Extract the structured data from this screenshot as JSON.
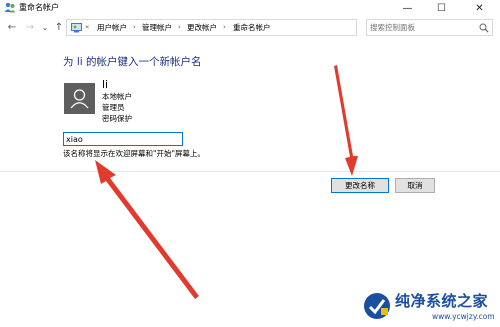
{
  "window": {
    "title": "重命名帐户",
    "min_glyph": "—",
    "max_glyph": "☐",
    "close_glyph": "✕"
  },
  "address_bar": {
    "back_glyph": "←",
    "forward_glyph": "→",
    "recent_glyph": "⌄",
    "up_glyph": "↑",
    "overflow": "«",
    "breadcrumbs": [
      "用户帐户",
      "管理帐户",
      "更改帐户",
      "重命名帐户"
    ],
    "separator": "›",
    "dropdown_glyph": "⌄",
    "refresh_glyph": "↻"
  },
  "search": {
    "placeholder": "搜索控制面板"
  },
  "content": {
    "heading": "为 li 的帐户键入一个新帐户名",
    "user": {
      "name": "li",
      "details": [
        "本地帐户",
        "管理员",
        "密码保护"
      ]
    },
    "new_name_value": "xiao",
    "hint": "该名称将显示在欢迎屏幕和\"开始\"屏幕上。"
  },
  "buttons": {
    "rename": "更改名称",
    "cancel": "取消"
  },
  "watermark": {
    "title": "纯净系统之家",
    "url": "www.ycwjzy.com"
  },
  "colors": {
    "heading": "#1e3287",
    "arrow": "#e23b2e",
    "accent": "#0078d7",
    "avatar_bg": "#5e5e5e"
  }
}
